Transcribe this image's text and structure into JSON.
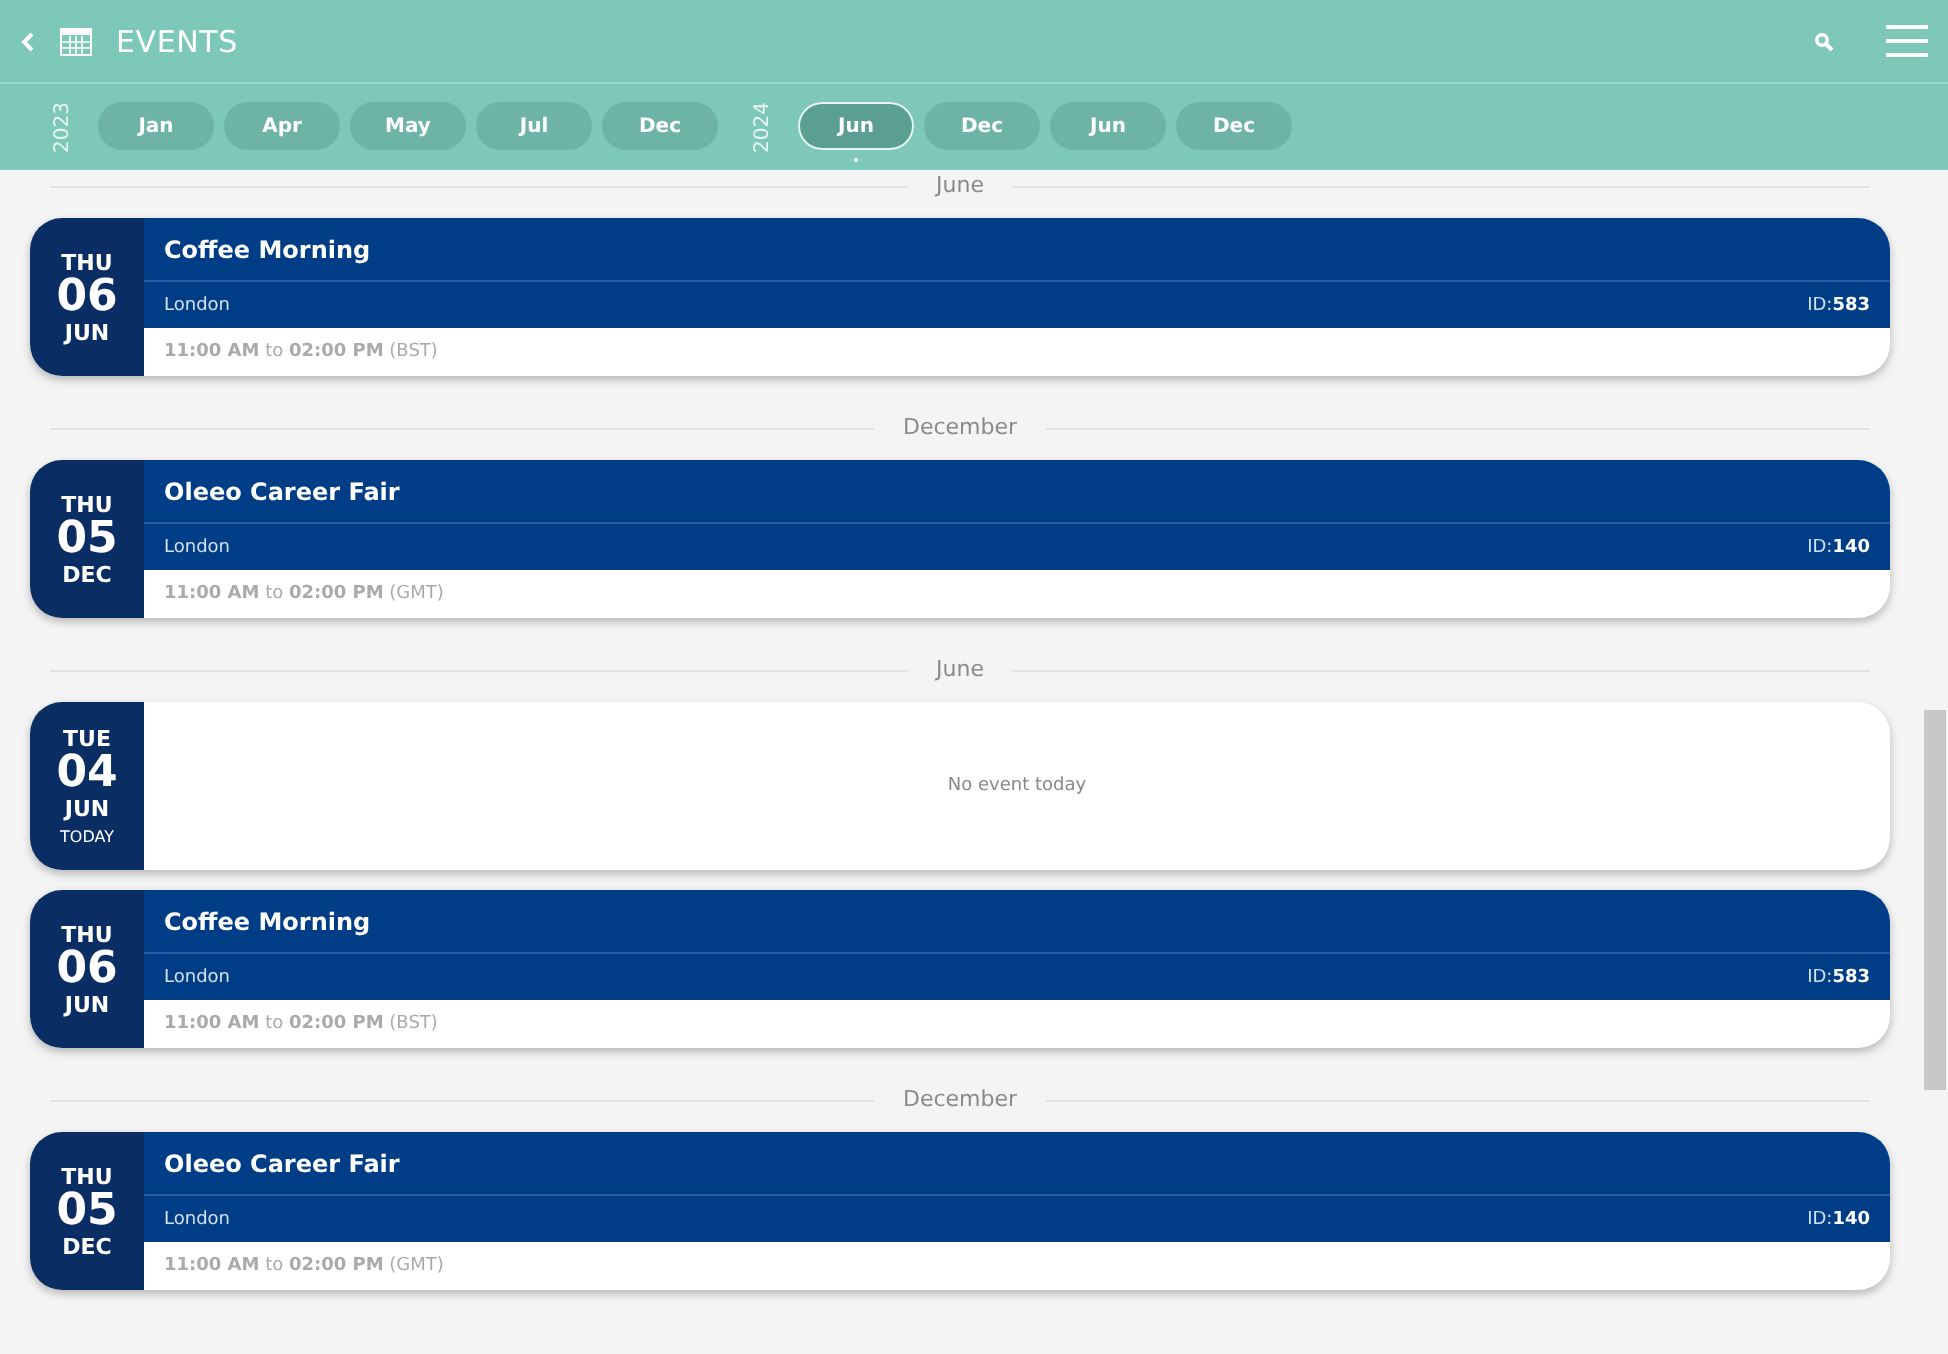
{
  "header": {
    "title": "EVENTS"
  },
  "timeline": [
    {
      "year": "2023",
      "months": [
        {
          "label": "Jan",
          "selected": false
        },
        {
          "label": "Apr",
          "selected": false
        },
        {
          "label": "May",
          "selected": false
        },
        {
          "label": "Jul",
          "selected": false
        },
        {
          "label": "Dec",
          "selected": false
        }
      ]
    },
    {
      "year": "2024",
      "months": [
        {
          "label": "Jun",
          "selected": true
        },
        {
          "label": "Dec",
          "selected": false
        },
        {
          "label": "Jun",
          "selected": false
        },
        {
          "label": "Dec",
          "selected": false
        }
      ]
    }
  ],
  "items": [
    {
      "kind": "divider",
      "label": "June"
    },
    {
      "kind": "event",
      "day": "THU",
      "date": "06",
      "month": "JUN",
      "title": "Coffee Morning",
      "location": "London",
      "id": "ID:**583**",
      "time": "**11:00 AM** to **02:00 PM** (BST)"
    },
    {
      "kind": "divider",
      "label": "December"
    },
    {
      "kind": "event",
      "day": "THU",
      "date": "05",
      "month": "DEC",
      "title": "Oleeo Career Fair",
      "location": "London",
      "id": "ID:**140**",
      "time": "**11:00 AM** to **02:00 PM** (GMT)"
    },
    {
      "kind": "divider",
      "label": "June"
    },
    {
      "kind": "empty",
      "day": "TUE",
      "date": "04",
      "month": "JUN",
      "note": "TODAY",
      "message": "No event today"
    },
    {
      "kind": "event",
      "day": "THU",
      "date": "06",
      "month": "JUN",
      "title": "Coffee Morning",
      "location": "London",
      "id": "ID:**583**",
      "time": "**11:00 AM** to **02:00 PM** (BST)"
    },
    {
      "kind": "divider",
      "label": "December"
    },
    {
      "kind": "event",
      "day": "THU",
      "date": "05",
      "month": "DEC",
      "title": "Oleeo Career Fair",
      "location": "London",
      "id": "ID:**140**",
      "time": "**11:00 AM** to **02:00 PM** (GMT)"
    }
  ]
}
